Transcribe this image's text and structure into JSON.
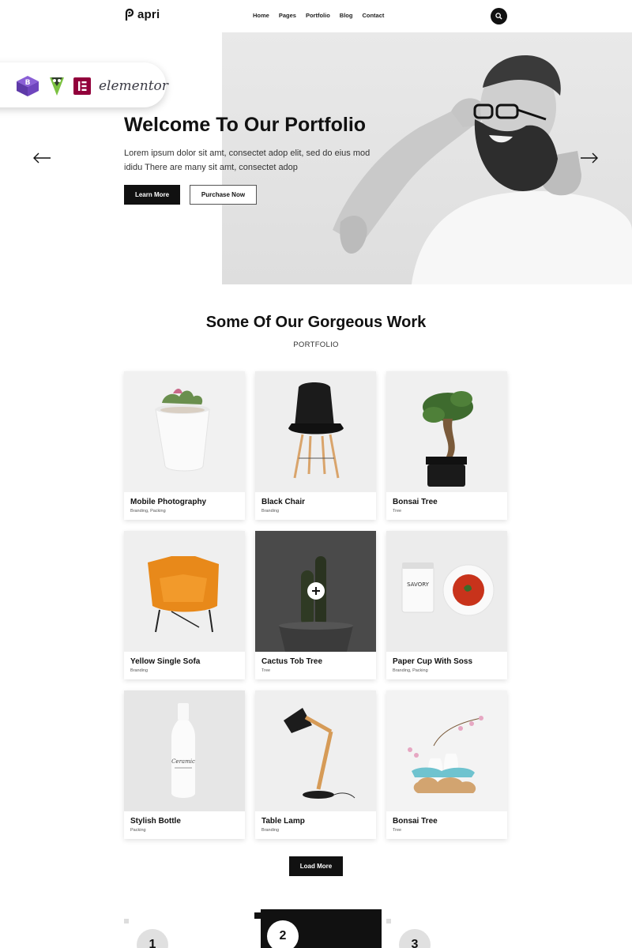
{
  "brand": {
    "name": "apri"
  },
  "nav": {
    "items": [
      "Home",
      "Pages",
      "Portfolio",
      "Blog",
      "Contact"
    ]
  },
  "hero": {
    "title": "Welcome To Our Portfolio",
    "text": "Lorem ipsum dolor sit amt, consectet adop elit, sed do eius mod ididu There are many sit amt, consectet adop",
    "primary_button": "Learn More",
    "secondary_button": "Purchase Now"
  },
  "badge": {
    "elementor_text": "elementor"
  },
  "portfolio": {
    "title": "Some Of Our Gorgeous Work",
    "subtitle": "PORTFOLIO",
    "items": [
      {
        "title": "Mobile Photography",
        "category": "Branding, Packing"
      },
      {
        "title": "Black Chair",
        "category": "Branding"
      },
      {
        "title": "Bonsai Tree",
        "category": "Tree"
      },
      {
        "title": "Yellow Single Sofa",
        "category": "Branding"
      },
      {
        "title": "Cactus Tob Tree",
        "category": "Tree"
      },
      {
        "title": "Paper Cup With Soss",
        "category": "Branding, Packing"
      },
      {
        "title": "Stylish Bottle",
        "category": "Packing"
      },
      {
        "title": "Table Lamp",
        "category": "Branding"
      },
      {
        "title": "Bonsai Tree",
        "category": "Tree"
      }
    ],
    "load_more": "Load More"
  },
  "steps": {
    "numbers": [
      "1",
      "2",
      "3"
    ]
  },
  "colors": {
    "primary": "#111111",
    "accent_orange": "#e8891a",
    "elementor": "#92003b"
  }
}
